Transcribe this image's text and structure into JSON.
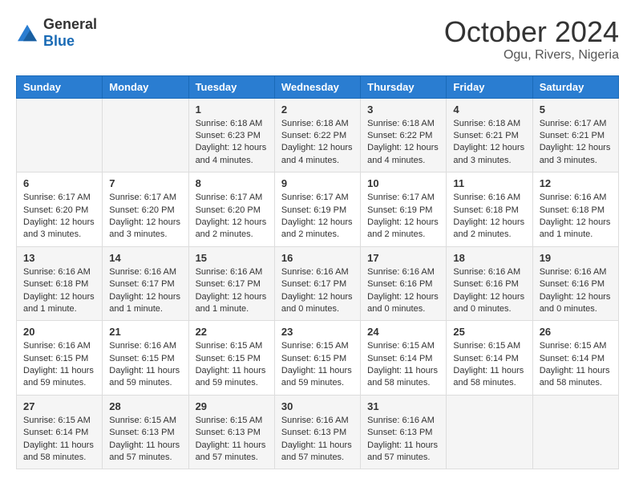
{
  "logo": {
    "general": "General",
    "blue": "Blue"
  },
  "title": "October 2024",
  "location": "Ogu, Rivers, Nigeria",
  "days": [
    "Sunday",
    "Monday",
    "Tuesday",
    "Wednesday",
    "Thursday",
    "Friday",
    "Saturday"
  ],
  "weeks": [
    [
      {
        "day": "",
        "text": ""
      },
      {
        "day": "",
        "text": ""
      },
      {
        "day": "1",
        "text": "Sunrise: 6:18 AM\nSunset: 6:23 PM\nDaylight: 12 hours and 4 minutes."
      },
      {
        "day": "2",
        "text": "Sunrise: 6:18 AM\nSunset: 6:22 PM\nDaylight: 12 hours and 4 minutes."
      },
      {
        "day": "3",
        "text": "Sunrise: 6:18 AM\nSunset: 6:22 PM\nDaylight: 12 hours and 4 minutes."
      },
      {
        "day": "4",
        "text": "Sunrise: 6:18 AM\nSunset: 6:21 PM\nDaylight: 12 hours and 3 minutes."
      },
      {
        "day": "5",
        "text": "Sunrise: 6:17 AM\nSunset: 6:21 PM\nDaylight: 12 hours and 3 minutes."
      }
    ],
    [
      {
        "day": "6",
        "text": "Sunrise: 6:17 AM\nSunset: 6:20 PM\nDaylight: 12 hours and 3 minutes."
      },
      {
        "day": "7",
        "text": "Sunrise: 6:17 AM\nSunset: 6:20 PM\nDaylight: 12 hours and 3 minutes."
      },
      {
        "day": "8",
        "text": "Sunrise: 6:17 AM\nSunset: 6:20 PM\nDaylight: 12 hours and 2 minutes."
      },
      {
        "day": "9",
        "text": "Sunrise: 6:17 AM\nSunset: 6:19 PM\nDaylight: 12 hours and 2 minutes."
      },
      {
        "day": "10",
        "text": "Sunrise: 6:17 AM\nSunset: 6:19 PM\nDaylight: 12 hours and 2 minutes."
      },
      {
        "day": "11",
        "text": "Sunrise: 6:16 AM\nSunset: 6:18 PM\nDaylight: 12 hours and 2 minutes."
      },
      {
        "day": "12",
        "text": "Sunrise: 6:16 AM\nSunset: 6:18 PM\nDaylight: 12 hours and 1 minute."
      }
    ],
    [
      {
        "day": "13",
        "text": "Sunrise: 6:16 AM\nSunset: 6:18 PM\nDaylight: 12 hours and 1 minute."
      },
      {
        "day": "14",
        "text": "Sunrise: 6:16 AM\nSunset: 6:17 PM\nDaylight: 12 hours and 1 minute."
      },
      {
        "day": "15",
        "text": "Sunrise: 6:16 AM\nSunset: 6:17 PM\nDaylight: 12 hours and 1 minute."
      },
      {
        "day": "16",
        "text": "Sunrise: 6:16 AM\nSunset: 6:17 PM\nDaylight: 12 hours and 0 minutes."
      },
      {
        "day": "17",
        "text": "Sunrise: 6:16 AM\nSunset: 6:16 PM\nDaylight: 12 hours and 0 minutes."
      },
      {
        "day": "18",
        "text": "Sunrise: 6:16 AM\nSunset: 6:16 PM\nDaylight: 12 hours and 0 minutes."
      },
      {
        "day": "19",
        "text": "Sunrise: 6:16 AM\nSunset: 6:16 PM\nDaylight: 12 hours and 0 minutes."
      }
    ],
    [
      {
        "day": "20",
        "text": "Sunrise: 6:16 AM\nSunset: 6:15 PM\nDaylight: 11 hours and 59 minutes."
      },
      {
        "day": "21",
        "text": "Sunrise: 6:16 AM\nSunset: 6:15 PM\nDaylight: 11 hours and 59 minutes."
      },
      {
        "day": "22",
        "text": "Sunrise: 6:15 AM\nSunset: 6:15 PM\nDaylight: 11 hours and 59 minutes."
      },
      {
        "day": "23",
        "text": "Sunrise: 6:15 AM\nSunset: 6:15 PM\nDaylight: 11 hours and 59 minutes."
      },
      {
        "day": "24",
        "text": "Sunrise: 6:15 AM\nSunset: 6:14 PM\nDaylight: 11 hours and 58 minutes."
      },
      {
        "day": "25",
        "text": "Sunrise: 6:15 AM\nSunset: 6:14 PM\nDaylight: 11 hours and 58 minutes."
      },
      {
        "day": "26",
        "text": "Sunrise: 6:15 AM\nSunset: 6:14 PM\nDaylight: 11 hours and 58 minutes."
      }
    ],
    [
      {
        "day": "27",
        "text": "Sunrise: 6:15 AM\nSunset: 6:14 PM\nDaylight: 11 hours and 58 minutes."
      },
      {
        "day": "28",
        "text": "Sunrise: 6:15 AM\nSunset: 6:13 PM\nDaylight: 11 hours and 57 minutes."
      },
      {
        "day": "29",
        "text": "Sunrise: 6:15 AM\nSunset: 6:13 PM\nDaylight: 11 hours and 57 minutes."
      },
      {
        "day": "30",
        "text": "Sunrise: 6:16 AM\nSunset: 6:13 PM\nDaylight: 11 hours and 57 minutes."
      },
      {
        "day": "31",
        "text": "Sunrise: 6:16 AM\nSunset: 6:13 PM\nDaylight: 11 hours and 57 minutes."
      },
      {
        "day": "",
        "text": ""
      },
      {
        "day": "",
        "text": ""
      }
    ]
  ]
}
